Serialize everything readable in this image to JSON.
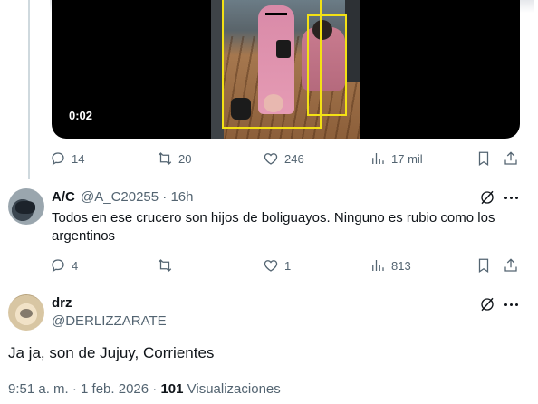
{
  "video": {
    "timestamp": "0:02"
  },
  "tweet1_actions": {
    "replies": "14",
    "reposts": "20",
    "likes": "246",
    "views": "17 mil"
  },
  "reply": {
    "name": "A/C",
    "handle_time": "@A_C20255 · 16h",
    "text": "Todos en ese crucero son hijos de boliguayos. Ninguno es rubio  como los argentinos",
    "replies": "4",
    "reposts": "",
    "likes": "1",
    "views": "813"
  },
  "main_post": {
    "name": "drz",
    "handle": "@DERLIZZARATE",
    "text": "Ja ja, son de Jujuy, Corrientes",
    "time": "9:51 a. m. · 1 feb. 2026 · ",
    "views_count": "101",
    "views_label": " Visualizaciones"
  },
  "icons": {
    "reply": "reply-icon",
    "repost": "repost-icon",
    "like": "heart-icon",
    "views": "views-icon",
    "bookmark": "bookmark-icon",
    "share": "share-icon",
    "grok": "grok-icon",
    "more": "more-icon"
  },
  "colors": {
    "text_primary": "#0f1419",
    "text_secondary": "#536471",
    "detection_box": "#f3e114"
  }
}
